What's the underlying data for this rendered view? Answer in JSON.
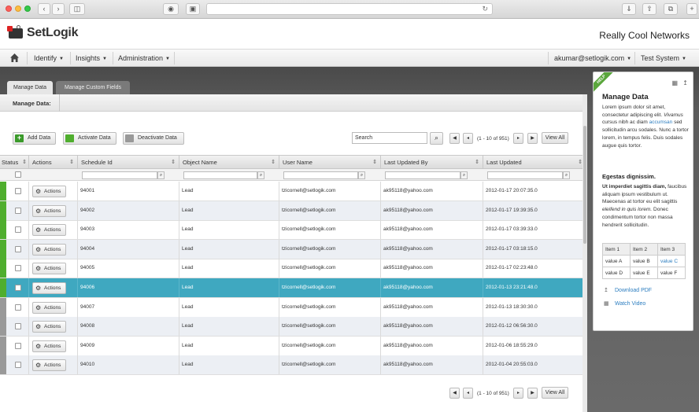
{
  "app": {
    "brand": "SetLogik",
    "company": "Really Cool Networks"
  },
  "nav": {
    "items": [
      "Identify",
      "Insights",
      "Administration"
    ],
    "user": "akumar@setlogik.com",
    "system": "Test System"
  },
  "tabs": [
    "Manage Data",
    "Manage Custom Fields"
  ],
  "breadcrumb": "Manage Data:",
  "toolbar": {
    "add": "Add Data",
    "activate": "Activate Data",
    "deactivate": "Deactivate Data",
    "search_placeholder": "Search",
    "page_info": "(1 - 10 of 951)",
    "view_all": "View All"
  },
  "grid": {
    "columns": [
      "Status",
      "Actions",
      "Schedule Id",
      "Object Name",
      "User Name",
      "Last Updated By",
      "Last Updated"
    ],
    "action_label": "Actions",
    "rows": [
      {
        "id": "94001",
        "object": "Lead",
        "user": "tzicornell@setlogik.com",
        "by": "ak95118@yahoo.com",
        "updated": "2012-01-17 20:07:35.0"
      },
      {
        "id": "94002",
        "object": "Lead",
        "user": "tzicornell@setlogik.com",
        "by": "ak95118@yahoo.com",
        "updated": "2012-01-17 19:39:35.0"
      },
      {
        "id": "94003",
        "object": "Lead",
        "user": "tzicornell@setlogik.com",
        "by": "ak95118@yahoo.com",
        "updated": "2012-01-17 03:39:33.0"
      },
      {
        "id": "94004",
        "object": "Lead",
        "user": "tzicornell@setlogik.com",
        "by": "ak95118@yahoo.com",
        "updated": "2012-01-17 03:18:15.0"
      },
      {
        "id": "94005",
        "object": "Lead",
        "user": "tzicornell@setlogik.com",
        "by": "ak95118@yahoo.com",
        "updated": "2012-01-17 02:23:48.0"
      },
      {
        "id": "94006",
        "object": "Lead",
        "user": "tzicornell@setlogik.com",
        "by": "ak95118@yahoo.com",
        "updated": "2012-01-13 23:21:48.0"
      },
      {
        "id": "94007",
        "object": "Lead",
        "user": "tzicornell@setlogik.com",
        "by": "ak95118@yahoo.com",
        "updated": "2012-01-13 18:30:30.0"
      },
      {
        "id": "94008",
        "object": "Lead",
        "user": "tzicornell@setlogik.com",
        "by": "ak95118@yahoo.com",
        "updated": "2012-01-12 06:56:30.0"
      },
      {
        "id": "94009",
        "object": "Lead",
        "user": "tzicornell@setlogik.com",
        "by": "ak95118@yahoo.com",
        "updated": "2012-01-06 18:55:29.0"
      },
      {
        "id": "94010",
        "object": "Lead",
        "user": "tzicornell@setlogik.com",
        "by": "ak95118@yahoo.com",
        "updated": "2012-01-04 20:55:03.0"
      }
    ],
    "status_colors": [
      "#4fae2e",
      "#4fae2e",
      "#4fae2e",
      "#4fae2e",
      "#4fae2e",
      "#4fae2e",
      "#999999",
      "#999999",
      "#999999",
      "#999999"
    ],
    "selected_index": 5
  },
  "help": {
    "ribbon": "HELP",
    "title": "Manage Data",
    "p1a": "Lorem ipsum dolor sit amet, consectetur adipiscing elit.",
    "p1b": "Vivamus",
    "p1c": "cursus nibh ac diam",
    "p1link": "accumsan",
    "p1d": "sed sollicitudin arcu sodales. Nunc a tortor lorem, in tempus felis. Duis sodales augue quis tortor.",
    "subtitle": "Egestas dignissim.",
    "p2a": "Ut imperdiet sagittis diam,",
    "p2b": "faucibus aliquam ipsum vestibulum ut. Maecenas at tortor eu elit sagittis",
    "p2c": "eleifend in quis lorem.",
    "p2d": "Donec condimentum tortor non massa hendrerit sollicitudin.",
    "table": [
      [
        "Item 1",
        "Item 2",
        "Item 3"
      ],
      [
        "value A",
        "value B",
        "value C"
      ],
      [
        "value D",
        "value E",
        "value F"
      ]
    ],
    "download": "Download PDF",
    "video": "Watch Video"
  }
}
